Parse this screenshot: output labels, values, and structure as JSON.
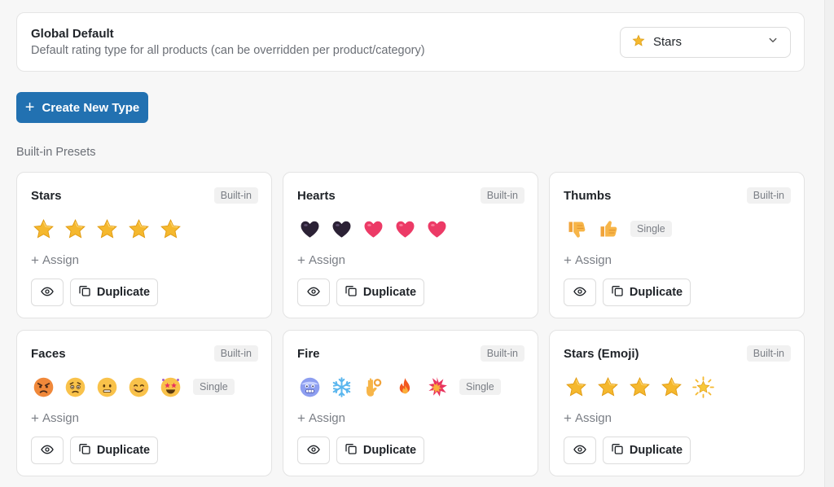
{
  "global_default": {
    "title": "Global Default",
    "description": "Default rating type for all products (can be overridden per product/category)",
    "selected": "Stars",
    "selected_icon": "star-icon"
  },
  "create_button": {
    "label": "Create New Type",
    "icon": "plus-icon"
  },
  "section_label": "Built-in Presets",
  "colors": {
    "primary": "#2271b1",
    "star": "#f5b82e",
    "heart": "#e8335e",
    "dark_heart": "#2a1f33"
  },
  "cards": [
    {
      "title": "Stars",
      "badge": "Built-in",
      "icons": [
        "star-icon",
        "star-icon",
        "star-icon",
        "star-icon",
        "star-icon"
      ],
      "single": "",
      "assign": "Assign",
      "duplicate": "Duplicate"
    },
    {
      "title": "Hearts",
      "badge": "Built-in",
      "icons": [
        "dark-heart-icon",
        "dark-heart-icon",
        "heart-icon",
        "heart-icon",
        "heart-icon"
      ],
      "single": "",
      "assign": "Assign",
      "duplicate": "Duplicate"
    },
    {
      "title": "Thumbs",
      "badge": "Built-in",
      "icons": [
        "thumbs-down-icon",
        "thumbs-up-icon"
      ],
      "single": "Single",
      "assign": "Assign",
      "duplicate": "Duplicate"
    },
    {
      "title": "Faces",
      "badge": "Built-in",
      "icons": [
        "angry-face-icon",
        "worried-face-icon",
        "neutral-face-icon",
        "smiling-face-icon",
        "star-struck-face-icon"
      ],
      "single": "Single",
      "assign": "Assign",
      "duplicate": "Duplicate"
    },
    {
      "title": "Fire",
      "badge": "Built-in",
      "icons": [
        "cold-face-icon",
        "snowflake-icon",
        "ok-hand-icon",
        "fire-icon",
        "explosion-icon"
      ],
      "single": "Single",
      "assign": "Assign",
      "duplicate": "Duplicate"
    },
    {
      "title": "Stars (Emoji)",
      "badge": "Built-in",
      "icons": [
        "star-icon",
        "star-icon",
        "star-icon",
        "star-icon",
        "glowing-star-icon"
      ],
      "single": "",
      "assign": "Assign",
      "duplicate": "Duplicate"
    }
  ]
}
